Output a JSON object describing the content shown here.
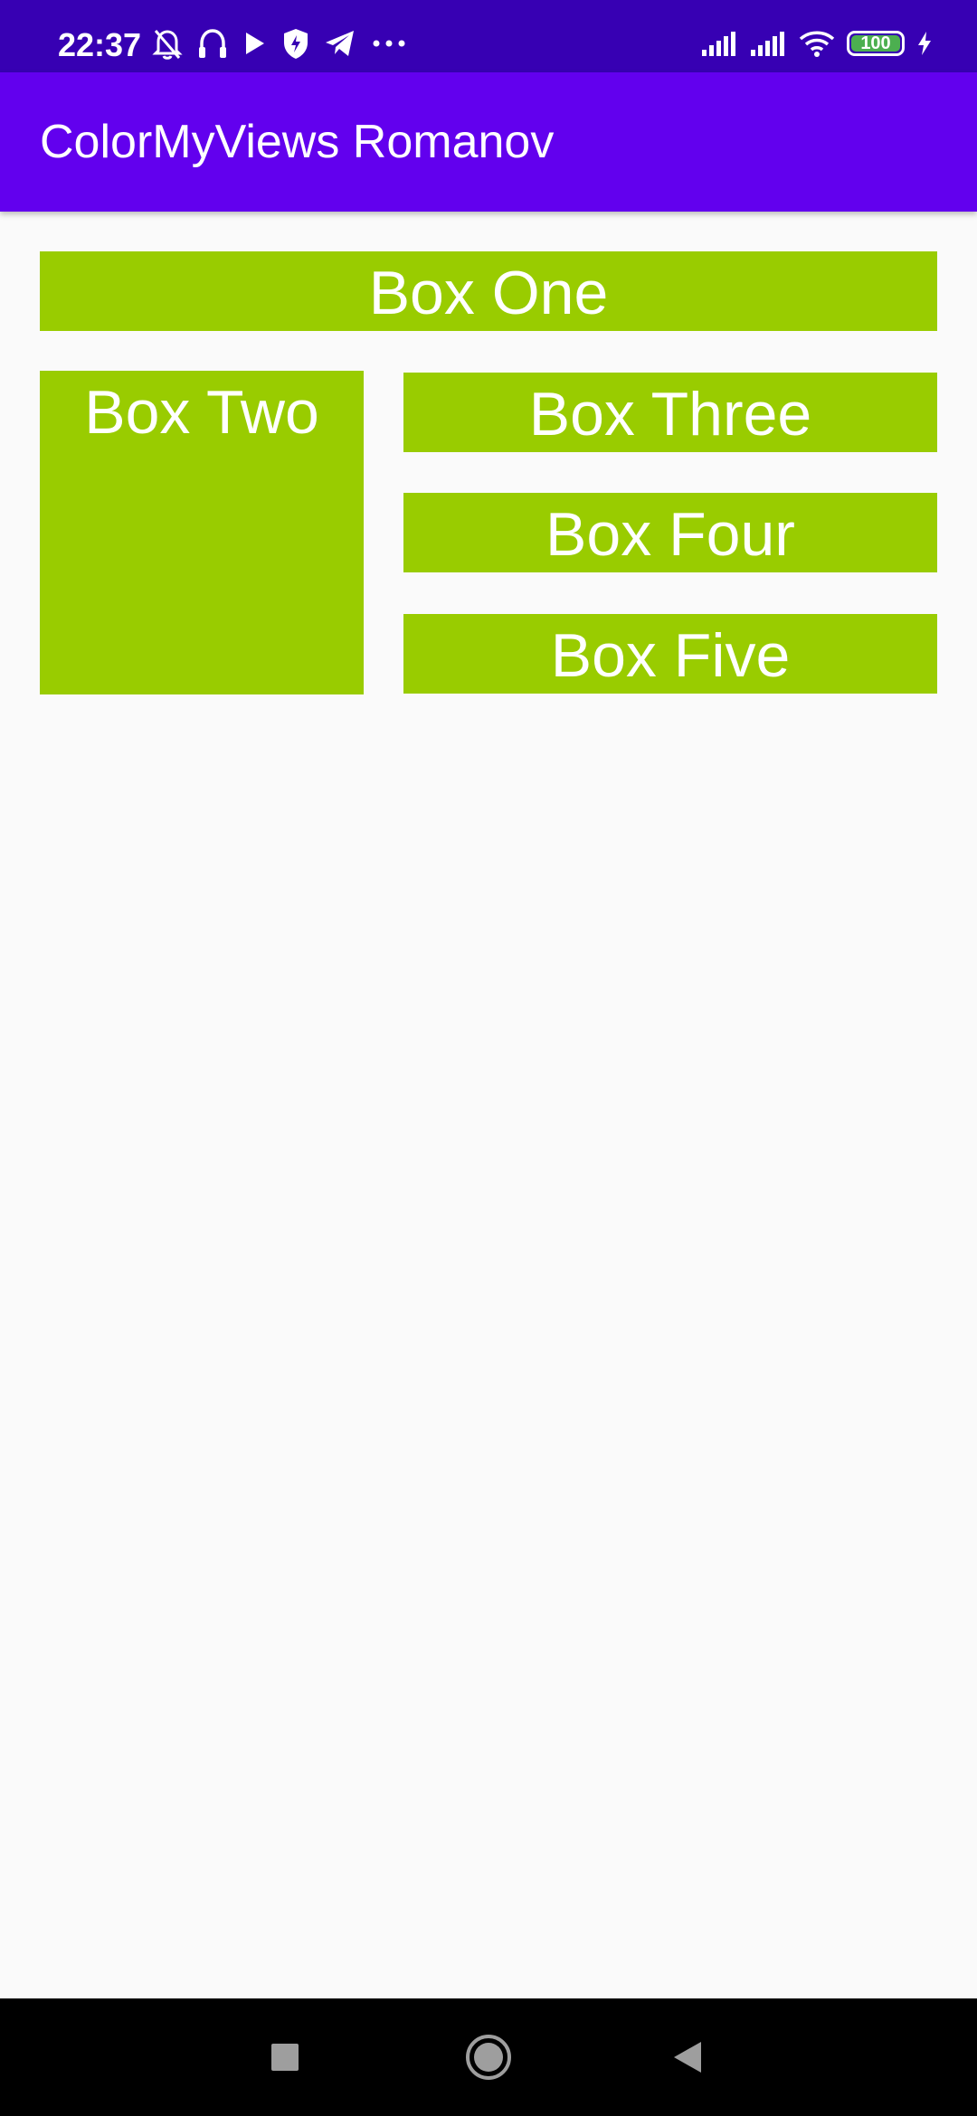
{
  "status_bar": {
    "time": "22:37",
    "battery_level": "100",
    "bg_color": "#3700b3",
    "left_icons": [
      "muted-bell-icon",
      "headphones-icon",
      "play-icon",
      "shield-icon",
      "telegram-icon",
      "more-dots-icon"
    ],
    "right_icons": [
      "signal-icon",
      "signal-icon",
      "wifi-icon",
      "battery-icon",
      "charging-icon"
    ]
  },
  "app_bar": {
    "title": "ColorMyViews Romanov",
    "bg_color": "#6200ee"
  },
  "boxes": {
    "box_one": "Box One",
    "box_two": "Box Two",
    "box_three": "Box Three",
    "box_four": "Box Four",
    "box_five": "Box Five",
    "color": "#99cc00"
  },
  "nav_bar": {
    "buttons": [
      "recent-apps-icon",
      "home-icon",
      "back-icon"
    ]
  }
}
